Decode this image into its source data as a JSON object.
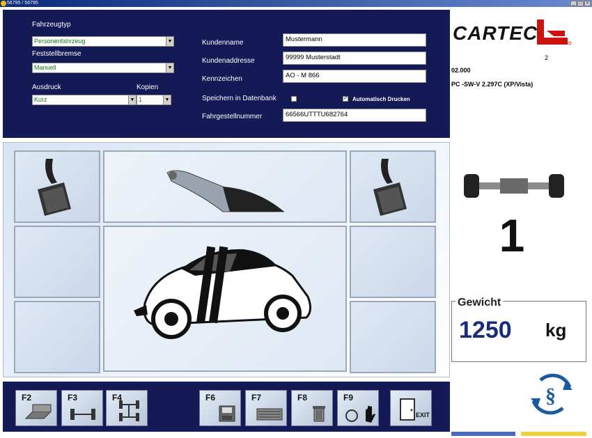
{
  "window": {
    "title": "56795 / 56795"
  },
  "form": {
    "fahrzeugtyp_label": "Fahrzeugtyp",
    "fahrzeugtyp_value": "Personenfahrzeug",
    "feststellbremse_label": "Feststellbremse",
    "feststellbremse_value": "Manuell",
    "ausdruck_label": "Ausdruck",
    "ausdruck_value": "Kurz",
    "kopien_label": "Kopien",
    "kopien_value": "1",
    "kundenname_label": "Kundenname",
    "kundenname_value": "Mustermann",
    "kundenaddresse_label": "Kundenaddresse",
    "kundenaddresse_value": "99999 Musterstadt",
    "kennzeichen_label": "Kennzeichen",
    "kennzeichen_value": "AO - M 866",
    "speichern_label": "Speichern in Datenbank",
    "speichern_checked": false,
    "auto_drucken_label": "Automatisch Drucken",
    "auto_drucken_checked": true,
    "fahrgestell_label": "Fahrgestellnummer",
    "fahrgestell_value": "66566UTTTU682764"
  },
  "brand": {
    "logo_text": "CARTEC",
    "logo_sub": "2",
    "version_line1": "02.000",
    "version_line2": "PC -SW-V 2.297C (XP/Vista)"
  },
  "axle": {
    "number": "1"
  },
  "weight": {
    "label": "Gewicht",
    "value": "1250",
    "unit": "kg"
  },
  "fkeys": [
    {
      "label": "F2",
      "icon": "scale-icon"
    },
    {
      "label": "F3",
      "icon": "axle-icon"
    },
    {
      "label": "F4",
      "icon": "two-axle-icon"
    },
    {
      "label": "F6",
      "icon": "save-icon"
    },
    {
      "label": "F7",
      "icon": "keyboard-icon"
    },
    {
      "label": "F8",
      "icon": "trash-icon"
    },
    {
      "label": "F9",
      "icon": "refresh-hand-icon"
    },
    {
      "label": "EXIT",
      "icon": "exit-door-icon"
    }
  ],
  "colors": {
    "navy": "#141a55",
    "weight_value": "#1a2a80",
    "brand_red": "#cc1111"
  }
}
